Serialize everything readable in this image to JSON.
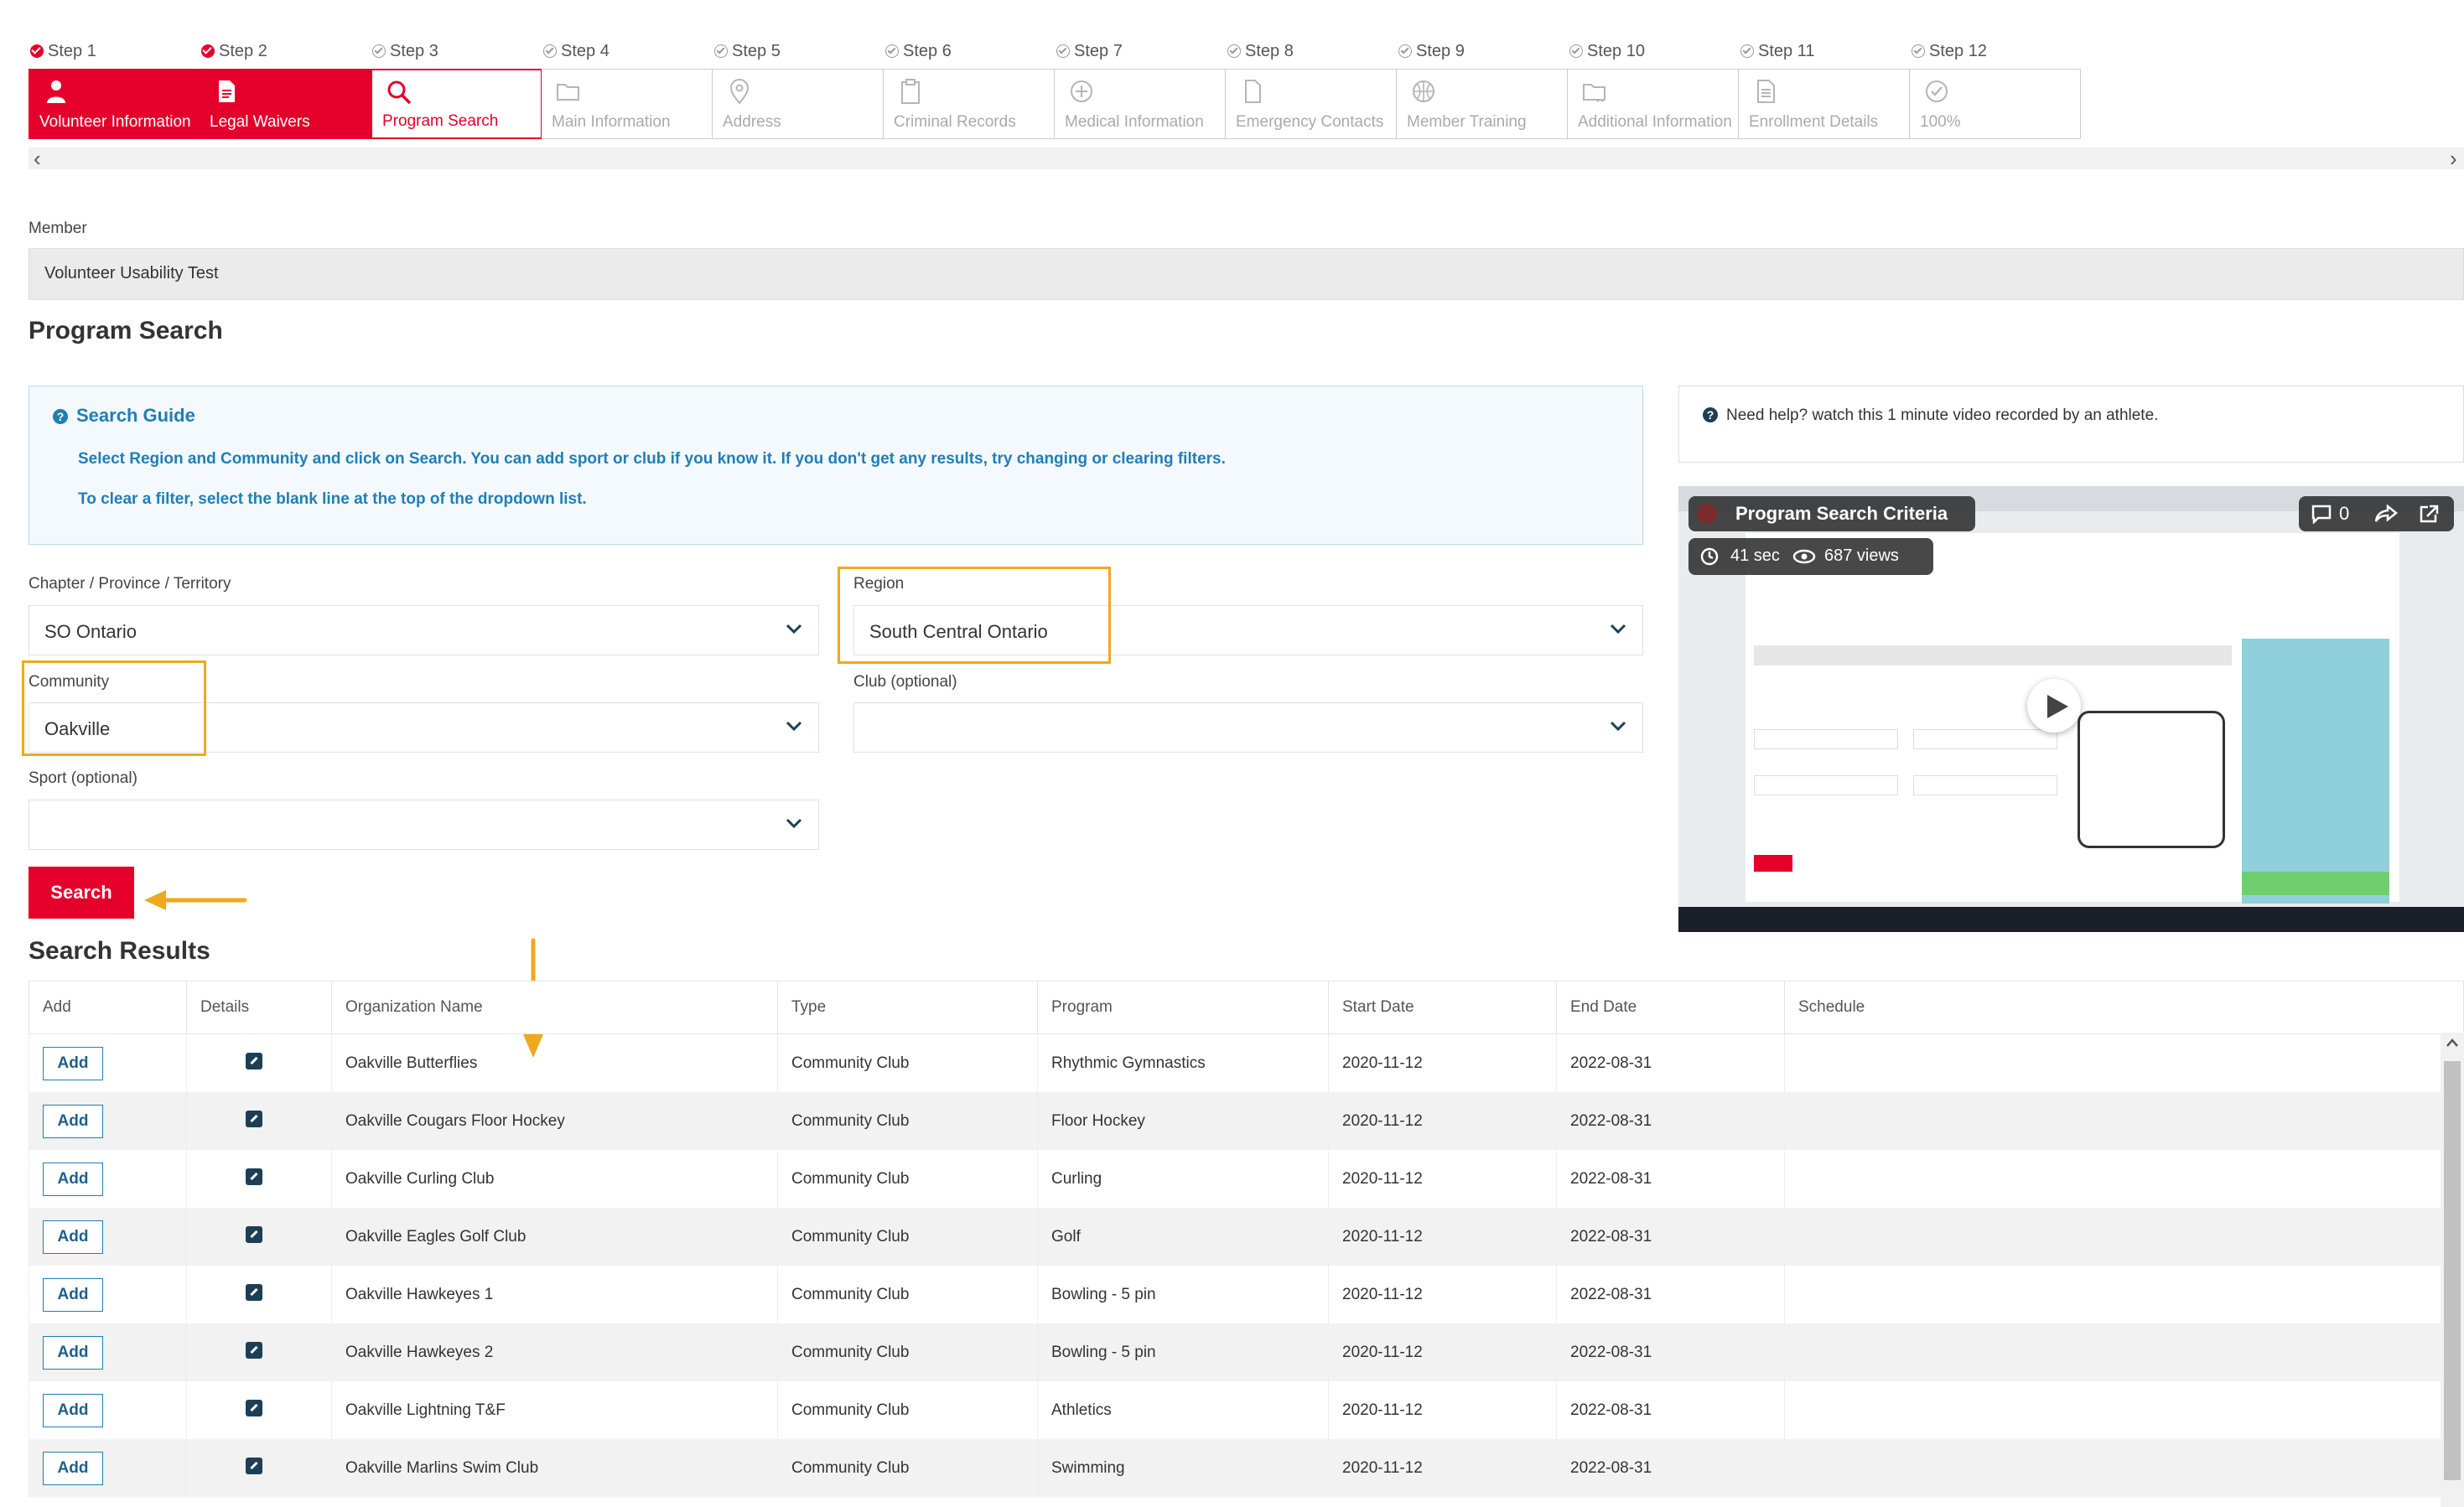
{
  "stepper": {
    "steps": [
      {
        "label": "Step 1",
        "name": "Volunteer Information",
        "status": "done",
        "icon": "person-icon"
      },
      {
        "label": "Step 2",
        "name": "Legal Waivers",
        "status": "done",
        "icon": "document-icon"
      },
      {
        "label": "Step 3",
        "name": "Program Search",
        "status": "current",
        "icon": "search-icon"
      },
      {
        "label": "Step 4",
        "name": "Main Information",
        "status": "todo",
        "icon": "folder-icon"
      },
      {
        "label": "Step 5",
        "name": "Address",
        "status": "todo",
        "icon": "map-pin-icon"
      },
      {
        "label": "Step 6",
        "name": "Criminal Records",
        "status": "todo",
        "icon": "clipboard-icon"
      },
      {
        "label": "Step 7",
        "name": "Medical Information",
        "status": "todo",
        "icon": "plus-circle-icon"
      },
      {
        "label": "Step 8",
        "name": "Emergency Contacts",
        "status": "todo",
        "icon": "file-icon"
      },
      {
        "label": "Step 9",
        "name": "Member Training",
        "status": "todo",
        "icon": "basketball-icon"
      },
      {
        "label": "Step 10",
        "name": "Additional Information",
        "status": "todo",
        "icon": "folder-dots-icon"
      },
      {
        "label": "Step 11",
        "name": "Enrollment Details",
        "status": "todo",
        "icon": "list-document-icon"
      },
      {
        "label": "Step 12",
        "name": "100%",
        "status": "todo",
        "icon": "check-circle-icon"
      }
    ],
    "scroll_left": "‹",
    "scroll_right": "›"
  },
  "member": {
    "label": "Member",
    "value": "Volunteer Usability Test"
  },
  "page_title": "Program Search",
  "guide": {
    "title": "Search Guide",
    "line1": "Select Region and Community and click on Search. You can add sport or club if you know it. If you don't get any results, try changing or clearing filters.",
    "line2": "To clear a filter, select the blank line at the top of the dropdown list."
  },
  "form": {
    "chapter": {
      "label": "Chapter / Province / Territory",
      "value": "SO Ontario"
    },
    "region": {
      "label": "Region",
      "value": "South Central Ontario"
    },
    "community": {
      "label": "Community",
      "value": "Oakville"
    },
    "club": {
      "label": "Club (optional)",
      "value": ""
    },
    "sport": {
      "label": "Sport (optional)",
      "value": ""
    },
    "search_label": "Search"
  },
  "help": {
    "text": "Need help? watch this 1 minute video recorded by an athlete.",
    "video_title": "Program Search Criteria",
    "duration": "41 sec",
    "views": "687 views",
    "comments": "0"
  },
  "results": {
    "title": "Search Results",
    "columns": [
      "Add",
      "Details",
      "Organization Name",
      "Type",
      "Program",
      "Start Date",
      "End Date",
      "Schedule"
    ],
    "add_label": "Add",
    "rows": [
      {
        "org": "Oakville Butterflies",
        "type": "Community Club",
        "program": "Rhythmic Gymnastics",
        "start": "2020-11-12",
        "end": "2022-08-31"
      },
      {
        "org": "Oakville Cougars Floor Hockey",
        "type": "Community Club",
        "program": "Floor Hockey",
        "start": "2020-11-12",
        "end": "2022-08-31"
      },
      {
        "org": "Oakville Curling Club",
        "type": "Community Club",
        "program": "Curling",
        "start": "2020-11-12",
        "end": "2022-08-31"
      },
      {
        "org": "Oakville Eagles Golf Club",
        "type": "Community Club",
        "program": "Golf",
        "start": "2020-11-12",
        "end": "2022-08-31"
      },
      {
        "org": "Oakville Hawkeyes 1",
        "type": "Community Club",
        "program": "Bowling - 5 pin",
        "start": "2020-11-12",
        "end": "2022-08-31"
      },
      {
        "org": "Oakville Hawkeyes 2",
        "type": "Community Club",
        "program": "Bowling - 5 pin",
        "start": "2020-11-12",
        "end": "2022-08-31"
      },
      {
        "org": "Oakville Lightning T&F",
        "type": "Community Club",
        "program": "Athletics",
        "start": "2020-11-12",
        "end": "2022-08-31"
      },
      {
        "org": "Oakville Marlins Swim Club",
        "type": "Community Club",
        "program": "Swimming",
        "start": "2020-11-12",
        "end": "2022-08-31"
      }
    ]
  },
  "colors": {
    "brand": "#e4002b",
    "info": "#1f7fb5",
    "highlight": "#f0a81f"
  }
}
